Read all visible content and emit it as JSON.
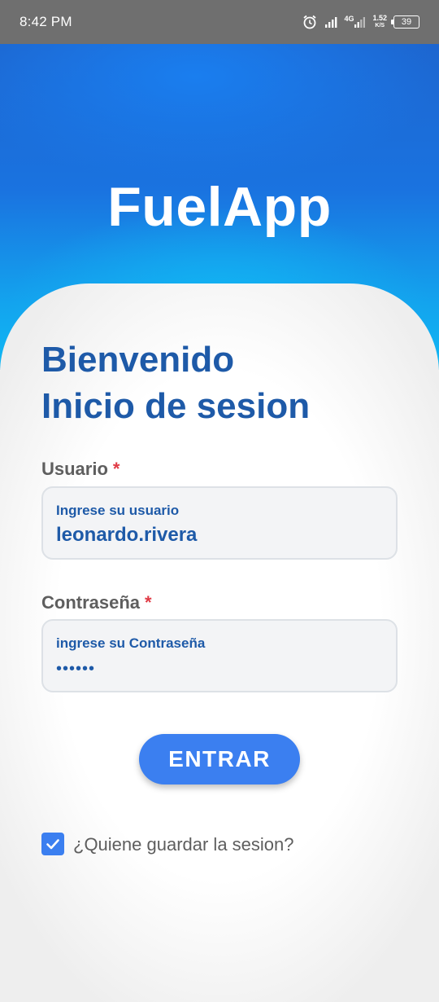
{
  "status_bar": {
    "time": "8:42 PM",
    "network_type": "4G",
    "speed_value": "1.52",
    "speed_unit": "K/S",
    "battery": "39",
    "icons": [
      "alarm-icon",
      "signal-icon",
      "signal-4g-icon",
      "battery-icon"
    ]
  },
  "header": {
    "app_title": "FuelApp"
  },
  "login": {
    "heading_line1": "Bienvenido",
    "heading_line2": "Inicio de sesion",
    "username": {
      "label": "Usuario",
      "required_mark": "*",
      "hint": "Ingrese su usuario",
      "value": "leonardo.rivera"
    },
    "password": {
      "label": "Contraseña",
      "required_mark": "*",
      "hint": "ingrese su Contraseña",
      "value": "••••••"
    },
    "submit_label": "ENTRAR",
    "remember": {
      "label": "¿Quiene guardar la sesion?",
      "checked": true
    }
  },
  "colors": {
    "primary_text": "#1e5aa8",
    "button": "#3b7ff0",
    "required": "#e03a45",
    "status_bar": "#6f6f6f"
  }
}
